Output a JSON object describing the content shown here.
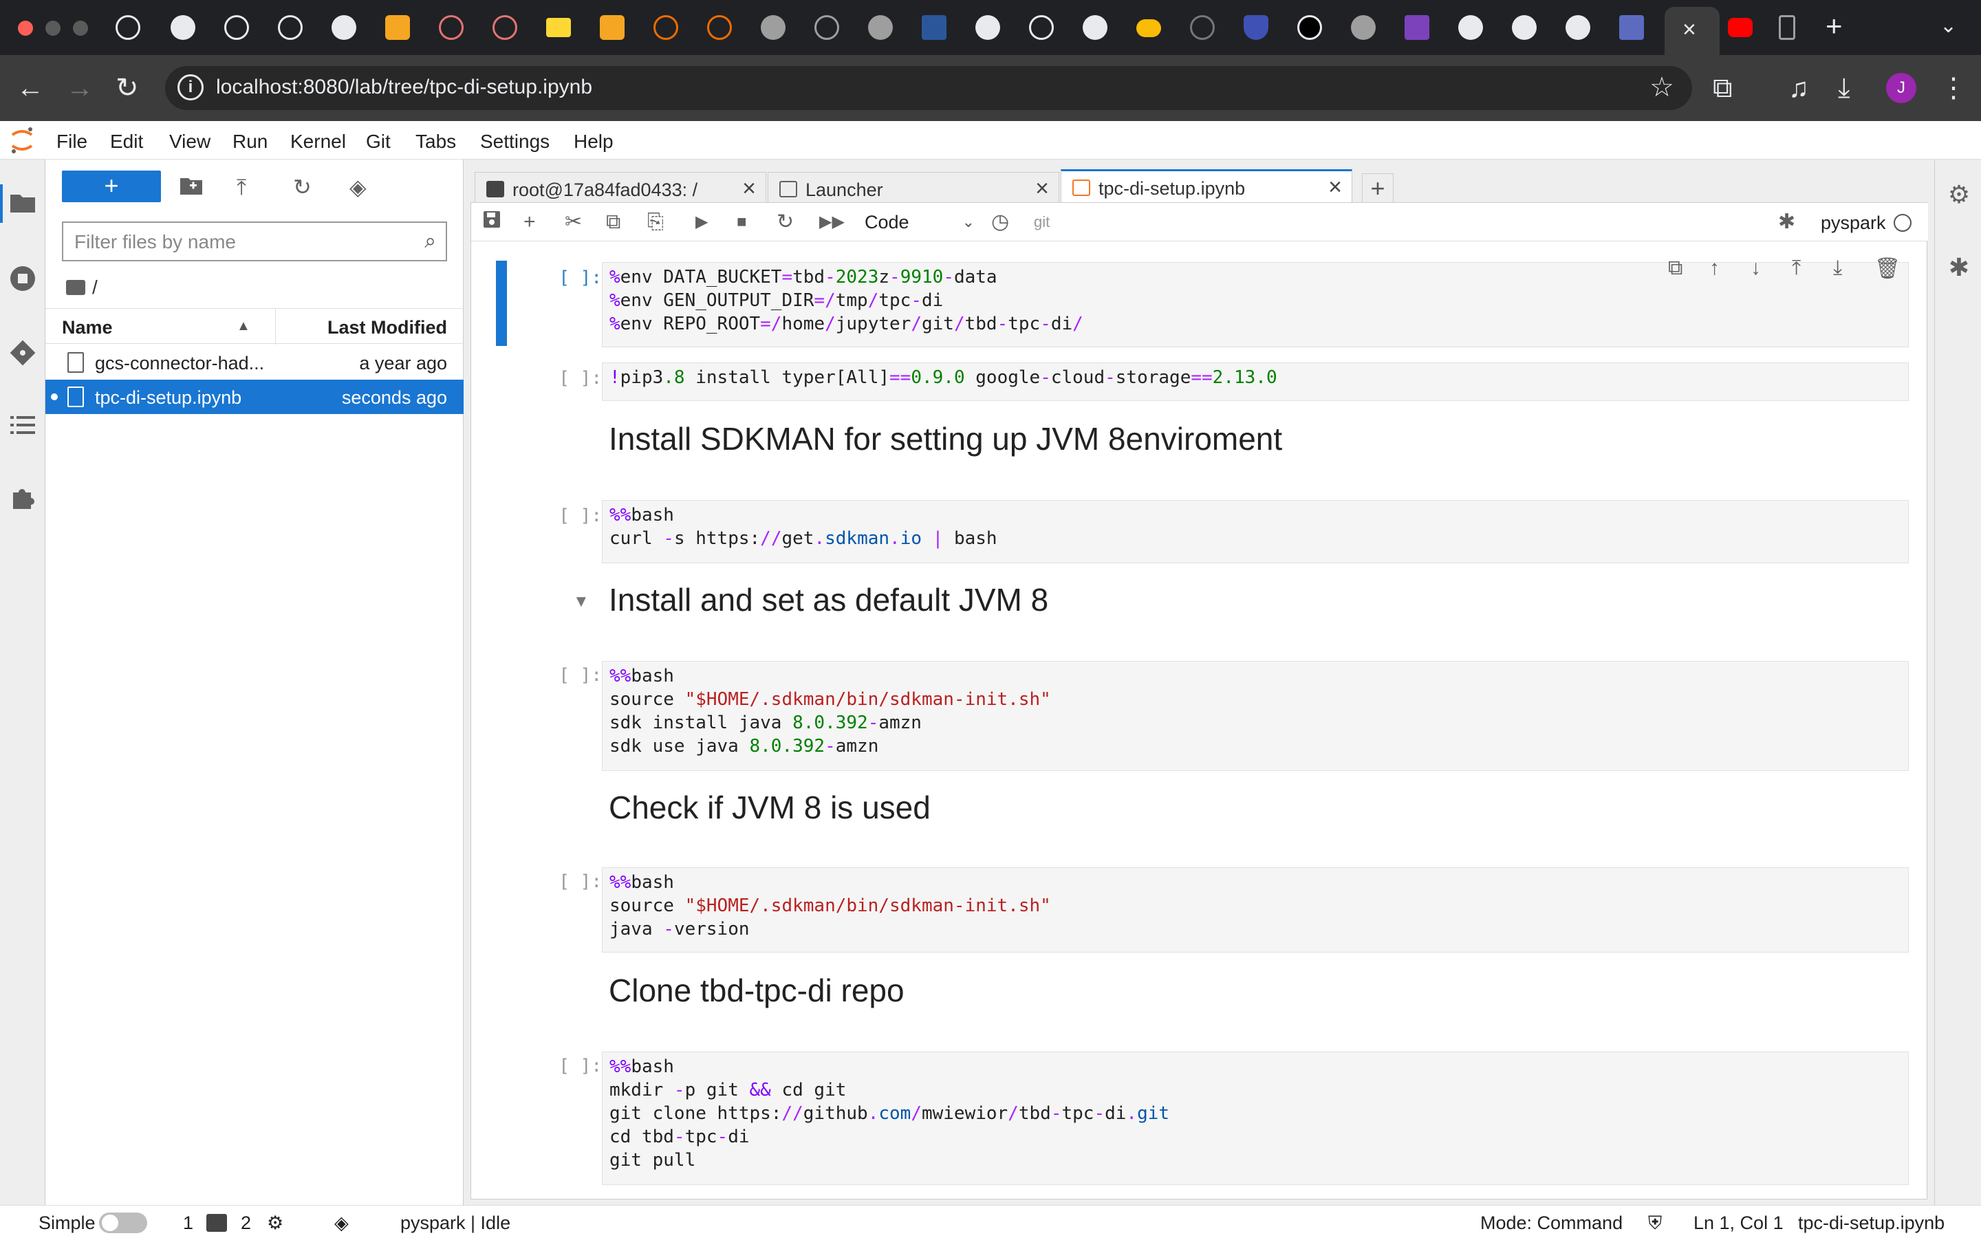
{
  "browser": {
    "url": "localhost:8080/lab/tree/tpc-di-setup.ipynb",
    "profile_initial": "J",
    "active_tab_close": "×",
    "new_tab": "+"
  },
  "menubar": {
    "items": [
      "File",
      "Edit",
      "View",
      "Run",
      "Kernel",
      "Git",
      "Tabs",
      "Settings",
      "Help"
    ]
  },
  "filebrowser": {
    "new_label": "+",
    "filter_placeholder": "Filter files by name",
    "breadcrumb": "/",
    "col_name": "Name",
    "col_modified": "Last Modified",
    "files": [
      {
        "name": "gcs-connector-had...",
        "modified": "a year ago"
      },
      {
        "name": "tpc-di-setup.ipynb",
        "modified": "seconds ago"
      }
    ]
  },
  "dock": {
    "tabs": [
      {
        "label": "root@17a84fad0433: /"
      },
      {
        "label": "Launcher"
      },
      {
        "label": "tpc-di-setup.ipynb"
      }
    ],
    "close_glyph": "×",
    "add_glyph": "+"
  },
  "notebook": {
    "cell_type": "Code",
    "git_label": "git",
    "kernel": "pyspark",
    "empty_prompt": "[ ]:",
    "headings": [
      "Install SDKMAN for setting up JVM 8enviroment",
      "Install and set as default JVM 8",
      "Check if JVM 8 is used",
      "Clone tbd-tpc-di repo"
    ]
  },
  "statusbar": {
    "mode_label": "Simple",
    "terminals": "1",
    "kernels": "2",
    "kernel_status": "pyspark | Idle",
    "mode": "Mode: Command",
    "cursor": "Ln 1, Col 1",
    "filename": "tpc-di-setup.ipynb"
  },
  "colors": {
    "accent": "#1976d2",
    "chrome_dark": "#202124",
    "chrome_bar": "#3c3c3c"
  },
  "icons": [
    "folder-icon",
    "running-icon",
    "git-icon",
    "toc-icon",
    "extension-icon",
    "property-inspector-icon",
    "debugger-icon",
    "save-icon",
    "cut-icon",
    "copy-icon",
    "paste-icon",
    "run-icon",
    "stop-icon",
    "restart-icon",
    "fast-forward-icon",
    "clock-icon",
    "bug-icon",
    "trash-icon"
  ]
}
